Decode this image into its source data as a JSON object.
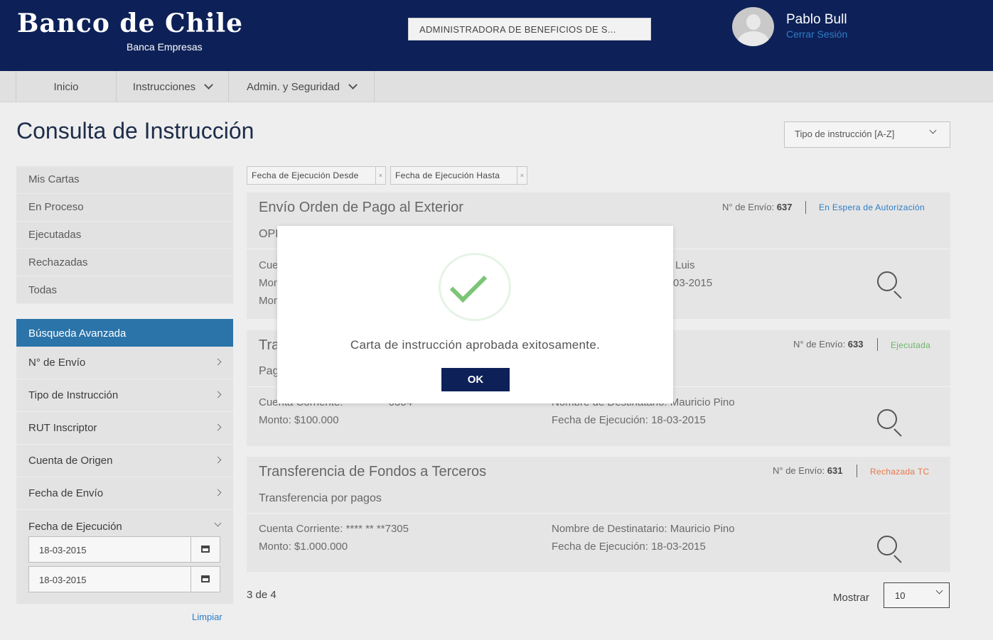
{
  "header": {
    "logo_title": "Banco de Chile",
    "logo_subtitle": "Banca Empresas",
    "company_selector": "ADMINISTRADORA DE BENEFICIOS DE S...",
    "user_name": "Pablo Bull",
    "logout_label": "Cerrar Sesión"
  },
  "nav": {
    "items": [
      {
        "label": "Inicio"
      },
      {
        "label": "Instrucciones"
      },
      {
        "label": "Admin. y Seguridad"
      }
    ]
  },
  "page": {
    "title": "Consulta de Instrucción",
    "sort_select": "Tipo de instrucción [A-Z]"
  },
  "sidebar": {
    "items": [
      {
        "label": "Mis Cartas"
      },
      {
        "label": "En Proceso"
      },
      {
        "label": "Ejecutadas"
      },
      {
        "label": "Rechazadas"
      },
      {
        "label": "Todas"
      }
    ],
    "advanced": {
      "header": "Búsqueda Avanzada",
      "filters": [
        {
          "label": "N° de Envío"
        },
        {
          "label": "Tipo de Instrucción"
        },
        {
          "label": "RUT Inscriptor"
        },
        {
          "label": "Cuenta de Origen"
        },
        {
          "label": "Fecha de Envío"
        },
        {
          "label": "Fecha de Ejecución"
        }
      ],
      "date_from": "18-03-2015",
      "date_to": "18-03-2015",
      "clear_label": "Limpiar"
    }
  },
  "chips": [
    {
      "label": "Fecha de Ejecución Desde",
      "close": "×"
    },
    {
      "label": "Fecha de Ejecución Hasta",
      "close": "×"
    }
  ],
  "cards": [
    {
      "title": "Envío Orden de Pago al Exterior",
      "env_label": "N° de Envío:",
      "env_number": "637",
      "status": "En Espera de Autorización",
      "status_color": "#2d7cc6",
      "subtitle": "OPI",
      "left_line1": "Cue",
      "left_line2": "Mon",
      "left_line3": "Mon",
      "right_line1": "Luis",
      "right_line2": "03-2015"
    },
    {
      "title": "Tra",
      "env_label": "N° de Envío:",
      "env_number": "633",
      "status": "Ejecutada",
      "status_color": "#6db56b",
      "subtitle": "Pag",
      "left_line1": "Cuenta Corriente:",
      "left_line1_value": "0304",
      "left_line2": "Monto: $100.000",
      "right_line1": "Nombre de Destinatario: Mauricio Pino",
      "right_line2": "Fecha de Ejecución: 18-03-2015"
    },
    {
      "title": "Transferencia de Fondos a Terceros",
      "env_label": "N° de Envío:",
      "env_number": "631",
      "status": "Rechazada TC",
      "status_color": "#e8764a",
      "subtitle": "Transferencia por pagos",
      "left_line1": "Cuenta Corriente: **** ** **7305",
      "left_line2": "Monto: $1.000.000",
      "right_line1": "Nombre de Destinatario: Mauricio Pino",
      "right_line2": "Fecha de Ejecución: 18-03-2015"
    }
  ],
  "pagination": {
    "summary": "3 de 4",
    "show_label": "Mostrar",
    "page_size": "10"
  },
  "modal": {
    "message": "Carta de instrucción aprobada exitosamente.",
    "ok_label": "OK"
  },
  "icons": {
    "avatar": "user-avatar-icon",
    "calendar": "calendar-icon",
    "search": "magnifier-icon",
    "success": "checkmark-icon"
  },
  "colors": {
    "header_bg": "#0d2158",
    "accent_blue": "#2b74aa",
    "link_blue": "#2d7cc6",
    "success_green": "#7cc576",
    "rejected_orange": "#e8764a"
  }
}
